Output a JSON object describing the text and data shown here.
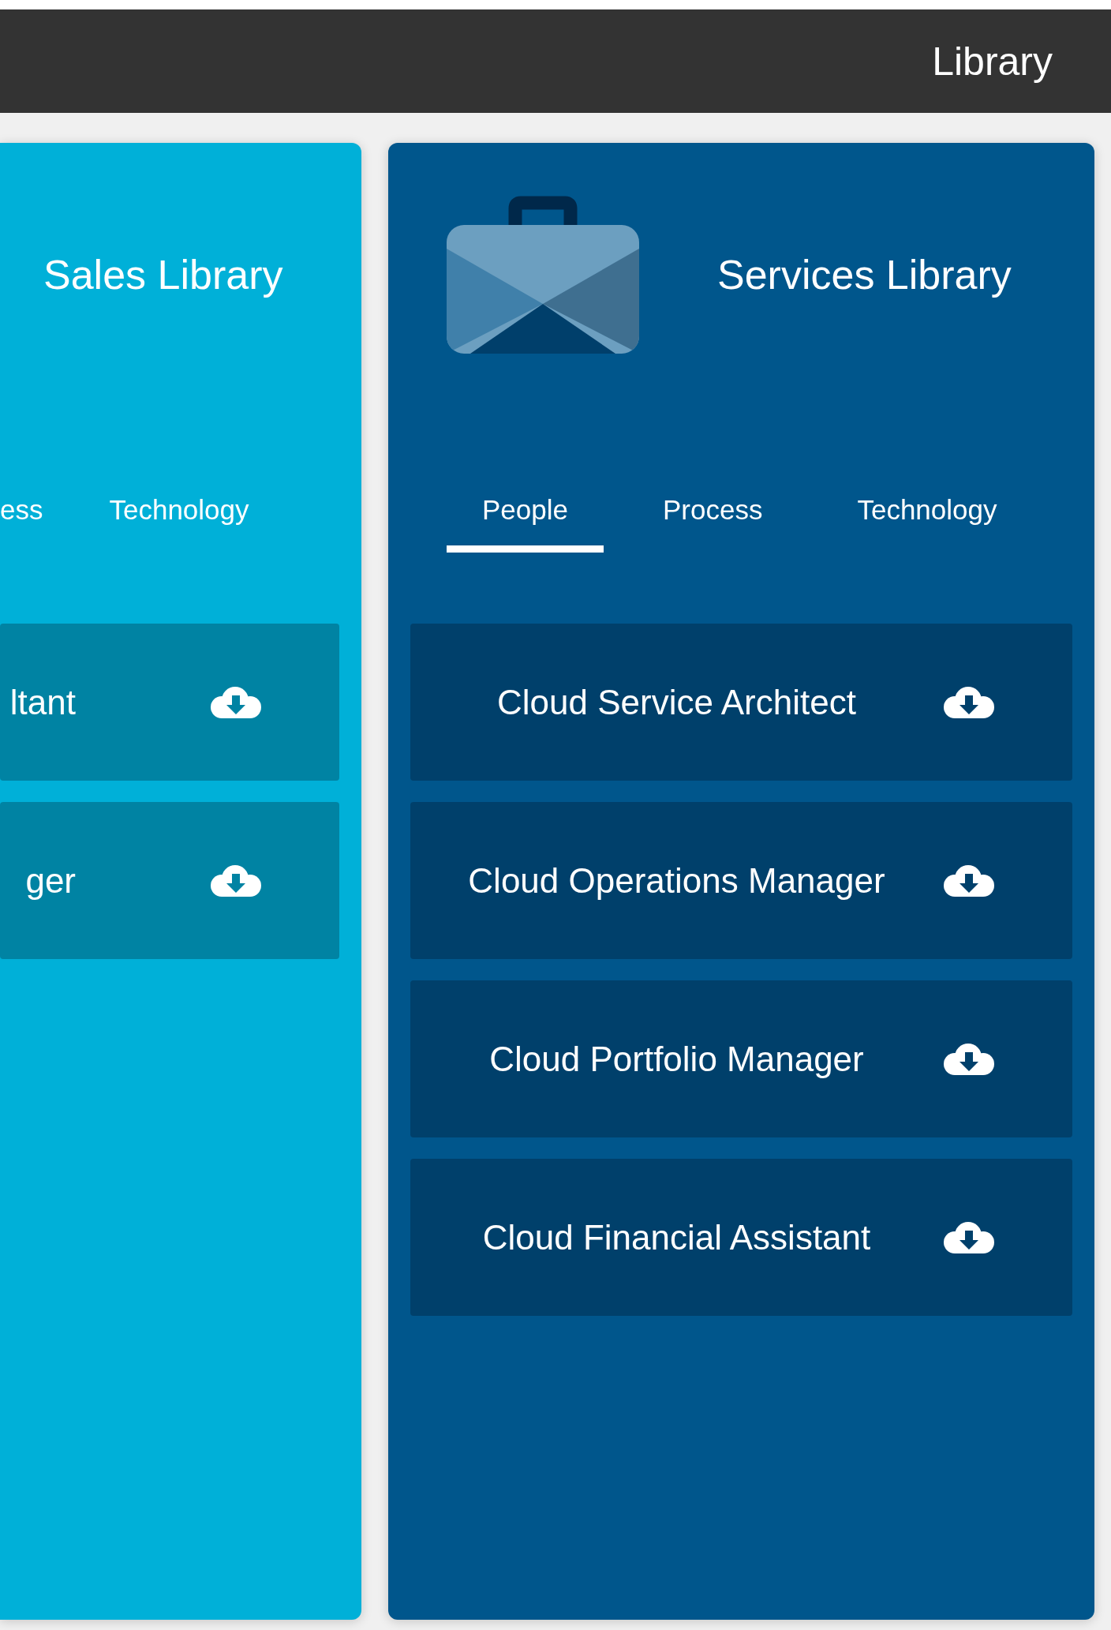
{
  "top_bar": {
    "title": "Library"
  },
  "libraries": [
    {
      "kind": "cut",
      "title": "Sales Library",
      "tabs": [
        {
          "label": "ess",
          "selected": false
        },
        {
          "label": "Technology",
          "selected": false
        }
      ],
      "items": [
        {
          "label": "ltant"
        },
        {
          "label": "ger"
        }
      ]
    },
    {
      "kind": "full",
      "title": "Services Library",
      "tabs": [
        {
          "label": "People",
          "selected": true
        },
        {
          "label": "Process",
          "selected": false
        },
        {
          "label": "Technology",
          "selected": false
        }
      ],
      "items": [
        {
          "label": "Cloud Service Architect"
        },
        {
          "label": "Cloud Operations Manager"
        },
        {
          "label": "Cloud Portfolio Manager"
        },
        {
          "label": "Cloud Financial Assistant"
        }
      ]
    }
  ]
}
